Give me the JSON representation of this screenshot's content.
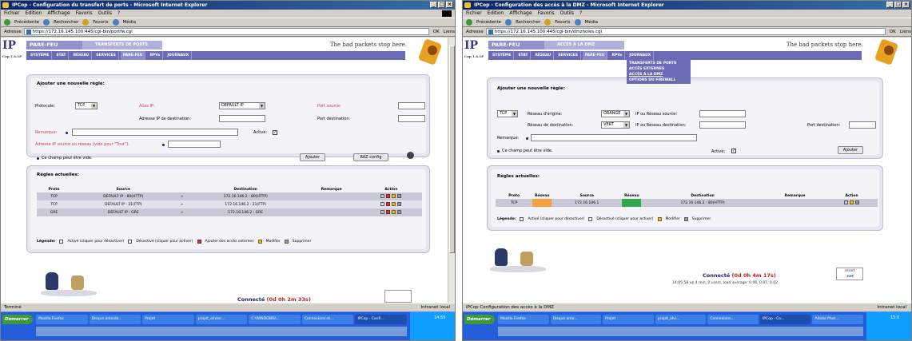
{
  "left": {
    "window_title": "IPCop - Configuration du transfert de ports - Microsoft Internet Explorer",
    "win_buttons": [
      "_",
      "□",
      "×"
    ],
    "menu": [
      "Fichier",
      "Edition",
      "Affichage",
      "Favoris",
      "Outils",
      "?"
    ],
    "toolbar": [
      "Précédente",
      "Rechercher",
      "Favoris",
      "Média"
    ],
    "address_label": "Adresse",
    "address": "https://172.16.145.100:445/cgi-bin/portfw.cgi",
    "go_label": "OK",
    "links_label": "Liens",
    "logo": "IP",
    "logo_sub": "Cop 1.4.1P",
    "banner_section": "PARE-FEU",
    "banner_sub": "TRANSFERTS DE PORTS",
    "tagline": "The bad packets stop here.",
    "nav": [
      "SYSTÈME",
      "ETAT",
      "RÉSEAU",
      "SERVICES",
      "PARE-FEU",
      "RPVs",
      "JOURNAUX"
    ],
    "active_nav": 4,
    "form_title": "Ajouter une nouvelle règle:",
    "protocole_label": "Protocole:",
    "protocole_value": "TCP",
    "alias_label": "Alias IP:",
    "alias_value": "DEFAULT IP",
    "port_src_label": "Port source:",
    "dest_ip_label": "Adresse IP de destination:",
    "port_dest_label": "Port destination:",
    "remark_label": "Remarque:",
    "active_label": "Activé:",
    "src_ip_label": "Adresse IP source ou réseau (vide pour \"Tout\"):",
    "empty_note": "Ce champ peut être vide.",
    "add_button": "Ajouter",
    "raz_button": "RAZ config",
    "rules_title": "Règles actuelles:",
    "columns": [
      "Proto",
      "Source",
      "",
      "Destination",
      "Remarque",
      "Action"
    ],
    "rules": [
      {
        "proto": "TCP",
        "source": "DEFAULT IP : 80(HTTP)",
        "dest": "172.16.146.2 : 80(HTTP)",
        "remark": ""
      },
      {
        "proto": "TCP",
        "source": "DEFAULT IP : 21(FTP)",
        "dest": "172.16.146.2 : 21(FTP)",
        "remark": ""
      },
      {
        "proto": "GRE",
        "source": "DEFAULT IP : GRE",
        "dest": "172.16.146.2 : GRE",
        "remark": ""
      }
    ],
    "legend_label": "Légende:",
    "legend_active": "Activé (cliquer pour désactiver)",
    "legend_inactive": "Désactivé (cliquer pour activer)",
    "legend_external": "Ajouter des accès externes",
    "legend_edit": "Modifier",
    "legend_delete": "Supprimer",
    "connected": "Connecté",
    "connected_time": "(0d 0h 2m 33s)",
    "status": "Terminé",
    "zone": "Intranet local",
    "taskbar_start": "Démarrer",
    "tasks": [
      "Mozilla Firefox",
      "Disque amovib...",
      "Projet",
      "projet_olivier...",
      "C:\\WINDOWS\\...",
      "Connexions ré...",
      "IPCop - Confi..."
    ],
    "clock": "14:55"
  },
  "right": {
    "window_title": "IPCop - Configuration des accès à la DMZ - Microsoft Internet Explorer",
    "win_buttons": [
      "_",
      "□",
      "×"
    ],
    "menu": [
      "Fichier",
      "Edition",
      "Affichage",
      "Favoris",
      "Outils",
      "?"
    ],
    "toolbar": [
      "Précédente",
      "Rechercher",
      "Favoris",
      "Média"
    ],
    "address_label": "Adresse",
    "address": "https://172.16.145.100:445/cgi-bin/dmzholes.cgi",
    "go_label": "OK",
    "links_label": "Liens",
    "logo": "IP",
    "logo_sub": "Cop 1.4.1P",
    "banner_section": "PARE-FEU",
    "banner_sub": "ACCÈS À LA DMZ",
    "tagline": "The bad packets stop here.",
    "nav": [
      "SYSTÈME",
      "ETAT",
      "RÉSEAU",
      "SERVICES",
      "PARE-FEU",
      "RPVs",
      "JOURNAUX"
    ],
    "active_nav": 4,
    "subnav": [
      "TRANSFERTS DE PORTS",
      "ACCÈS EXTERNES",
      "ACCÈS À LA DMZ",
      "OPTIONS DU FIREWALL"
    ],
    "form_title": "Ajouter une nouvelle règle:",
    "protocole_value": "TCP",
    "src_net_label": "Réseau d'origine:",
    "src_net_value": "ORANGE",
    "src_ip_label": "IP ou Réseau source:",
    "dest_net_label": "Réseau de destination:",
    "dest_net_value": "VERT",
    "dest_ip_label": "IP ou Réseau destination:",
    "port_dest_label": "Port destination:",
    "remark_label": "Remarque:",
    "empty_note": "Ce champ peut être vide.",
    "active_label": "Activé:",
    "add_button": "Ajouter",
    "rules_title": "Règles actuelles:",
    "columns": [
      "Proto",
      "Réseau",
      "Source",
      "Réseau",
      "Destination",
      "Remarque",
      "Action"
    ],
    "rules": [
      {
        "proto": "TCP",
        "src_color": "#f5a03c",
        "source": "172.16.146.1",
        "dest_color": "#2ea84a",
        "dest": "172.16.146.2 : 80(HTTP)",
        "remark": ""
      }
    ],
    "legend_label": "Légende:",
    "legend_active": "Activé (cliquer pour désactiver)",
    "legend_inactive": "Désactivé (cliquer pour activer)",
    "legend_edit": "Modifier",
    "legend_delete": "Supprimer",
    "connected": "Connecté",
    "connected_time": "(0d 0h 4m 17s)",
    "uptime": "14:05:58 up 4 min, 0 users, load average: 0.06, 0.07, 0.02",
    "smartnet_line1": "smart",
    "smartnet_line2": ".net",
    "status": "IPCop Configuration des accès à la DMZ",
    "zone": "Intranet local",
    "taskbar_start": "Démarrer",
    "tasks": [
      "Mozilla Firefox",
      "Disque amo...",
      "Projet",
      "projet_olvi...",
      "Connexions...",
      "IPCop - Co...",
      "Adobe Phot..."
    ],
    "clock": "15:0"
  },
  "colors": {
    "accent": "#6b6bb5",
    "orange": "#f5a03c",
    "green": "#2ea84a"
  }
}
